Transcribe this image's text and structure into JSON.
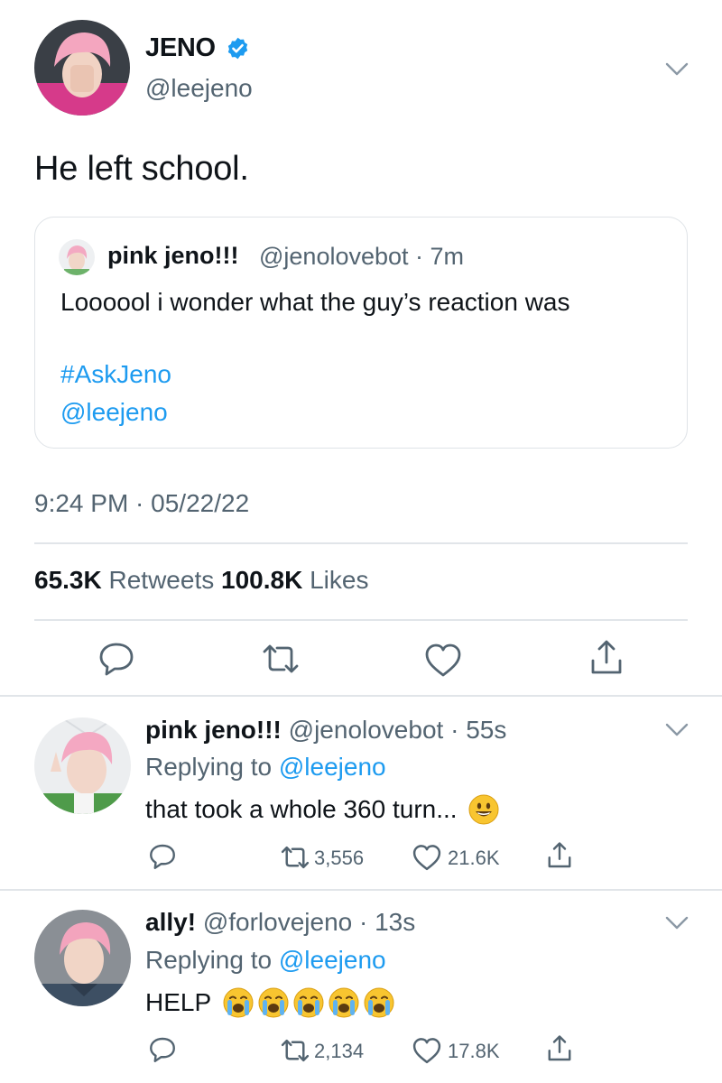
{
  "tweet": {
    "name": "JENO",
    "handle": "@leejeno",
    "text": "He left school.",
    "timestamp": "9:24 PM · 05/22/22",
    "quote": {
      "name": "pink jeno!!!",
      "handle_time": "@jenolovebot · 7m",
      "text": "Loooool i wonder what the guy’s reaction was",
      "hashtag": "#AskJeno",
      "mention": "@leejeno"
    },
    "stats": {
      "retweets_count": "65.3K",
      "retweets_label": "Retweets",
      "likes_count": "100.8K",
      "likes_label": "Likes"
    },
    "actions": [
      "reply-icon",
      "retweet-icon",
      "like-icon",
      "share-icon"
    ]
  },
  "replies": [
    {
      "name": "pink jeno!!!",
      "handle_time": "@jenolovebot · 55s",
      "replying_label": "Replying to",
      "replying_to": "@leejeno",
      "text": "that took a whole 360 turn...",
      "emoji": [
        "smiling-face-emoji"
      ],
      "retweets": "3,556",
      "likes": "21.6K"
    },
    {
      "name": "ally!",
      "handle_time": "@forlovejeno · 13s",
      "replying_label": "Replying to",
      "replying_to": "@leejeno",
      "text": "HELP",
      "emoji": [
        "crying-face-emoji",
        "crying-face-emoji",
        "crying-face-emoji",
        "crying-face-emoji",
        "crying-face-emoji"
      ],
      "retweets": "2,134",
      "likes": "17.8K"
    }
  ],
  "colors": {
    "accent": "#1d9bf0",
    "secondary_text": "#536471",
    "divider": "#e1e5e9"
  }
}
